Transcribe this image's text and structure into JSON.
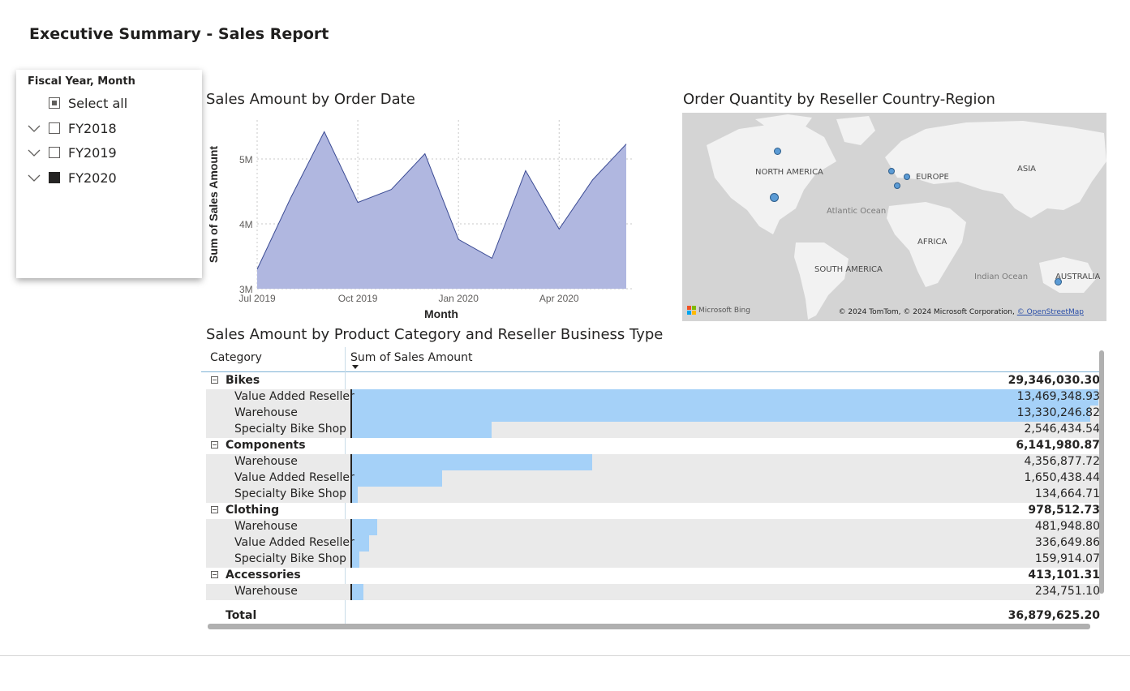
{
  "report": {
    "title": "Executive Summary - Sales Report"
  },
  "slicer": {
    "title": "Fiscal Year, Month",
    "items": [
      {
        "label": "Select all",
        "state": "partial",
        "expandable": false
      },
      {
        "label": "FY2018",
        "state": "unchecked",
        "expandable": true
      },
      {
        "label": "FY2019",
        "state": "unchecked",
        "expandable": true
      },
      {
        "label": "FY2020",
        "state": "checked",
        "expandable": true
      }
    ]
  },
  "area_chart": {
    "title": "Sales Amount by Order Date",
    "color": "#b0b7e0",
    "line_color": "#3b4b94"
  },
  "map": {
    "title": "Order Quantity by Reseller Country-Region",
    "labels": {
      "north_america": "NORTH AMERICA",
      "europe": "EUROPE",
      "asia": "ASIA",
      "africa": "AFRICA",
      "south_america": "SOUTH AMERICA",
      "australia": "AUSTRALIA",
      "atlantic": "Atlantic Ocean",
      "indian": "Indian Ocean"
    },
    "logo_text": "Microsoft Bing",
    "credit_text": "© 2024 TomTom, © 2024 Microsoft Corporation,",
    "credit_link": "© OpenStreetMap",
    "bubble_color": "#5b9bd5"
  },
  "matrix": {
    "title": "Sales Amount by Product Category and Reseller Business Type",
    "col_category": "Category",
    "col_value": "Sum of Sales Amount",
    "bar_color": "#a5d1f8",
    "groups": [
      {
        "name": "Bikes",
        "total": "29,346,030.30",
        "rows": [
          {
            "label": "Value Added Reseller",
            "value": "13,469,348.93",
            "amount": 13469348.93
          },
          {
            "label": "Warehouse",
            "value": "13,330,246.82",
            "amount": 13330246.82
          },
          {
            "label": "Specialty Bike Shop",
            "value": "2,546,434.54",
            "amount": 2546434.54
          }
        ]
      },
      {
        "name": "Components",
        "total": "6,141,980.87",
        "rows": [
          {
            "label": "Warehouse",
            "value": "4,356,877.72",
            "amount": 4356877.72
          },
          {
            "label": "Value Added Reseller",
            "value": "1,650,438.44",
            "amount": 1650438.44
          },
          {
            "label": "Specialty Bike Shop",
            "value": "134,664.71",
            "amount": 134664.71
          }
        ]
      },
      {
        "name": "Clothing",
        "total": "978,512.73",
        "rows": [
          {
            "label": "Warehouse",
            "value": "481,948.80",
            "amount": 481948.8
          },
          {
            "label": "Value Added Reseller",
            "value": "336,649.86",
            "amount": 336649.86
          },
          {
            "label": "Specialty Bike Shop",
            "value": "159,914.07",
            "amount": 159914.07
          }
        ]
      },
      {
        "name": "Accessories",
        "total": "413,101.31",
        "rows": [
          {
            "label": "Warehouse",
            "value": "234,751.10",
            "amount": 234751.1
          }
        ]
      }
    ],
    "total_label": "Total",
    "total_value": "36,879,625.20"
  },
  "chart_data": {
    "type": "area",
    "title": "Sales Amount by Order Date",
    "xlabel": "Month",
    "ylabel": "Sum of Sales Amount",
    "x": [
      "2019-07",
      "2019-08",
      "2019-09",
      "2019-10",
      "2019-11",
      "2019-12",
      "2020-01",
      "2020-02",
      "2020-03",
      "2020-04",
      "2020-05",
      "2020-06"
    ],
    "x_tick_labels": [
      "Jul 2019",
      "Oct 2019",
      "Jan 2020",
      "Apr 2020"
    ],
    "y_tick_labels": [
      "3M",
      "4M",
      "5M"
    ],
    "y_ticks": [
      3000000,
      4000000,
      5000000
    ],
    "values": [
      3300000,
      4400000,
      5420000,
      4330000,
      4530000,
      5080000,
      3760000,
      3470000,
      4820000,
      3920000,
      4680000,
      5230000
    ],
    "ylim": [
      3000000,
      5600000
    ],
    "grid": true
  }
}
